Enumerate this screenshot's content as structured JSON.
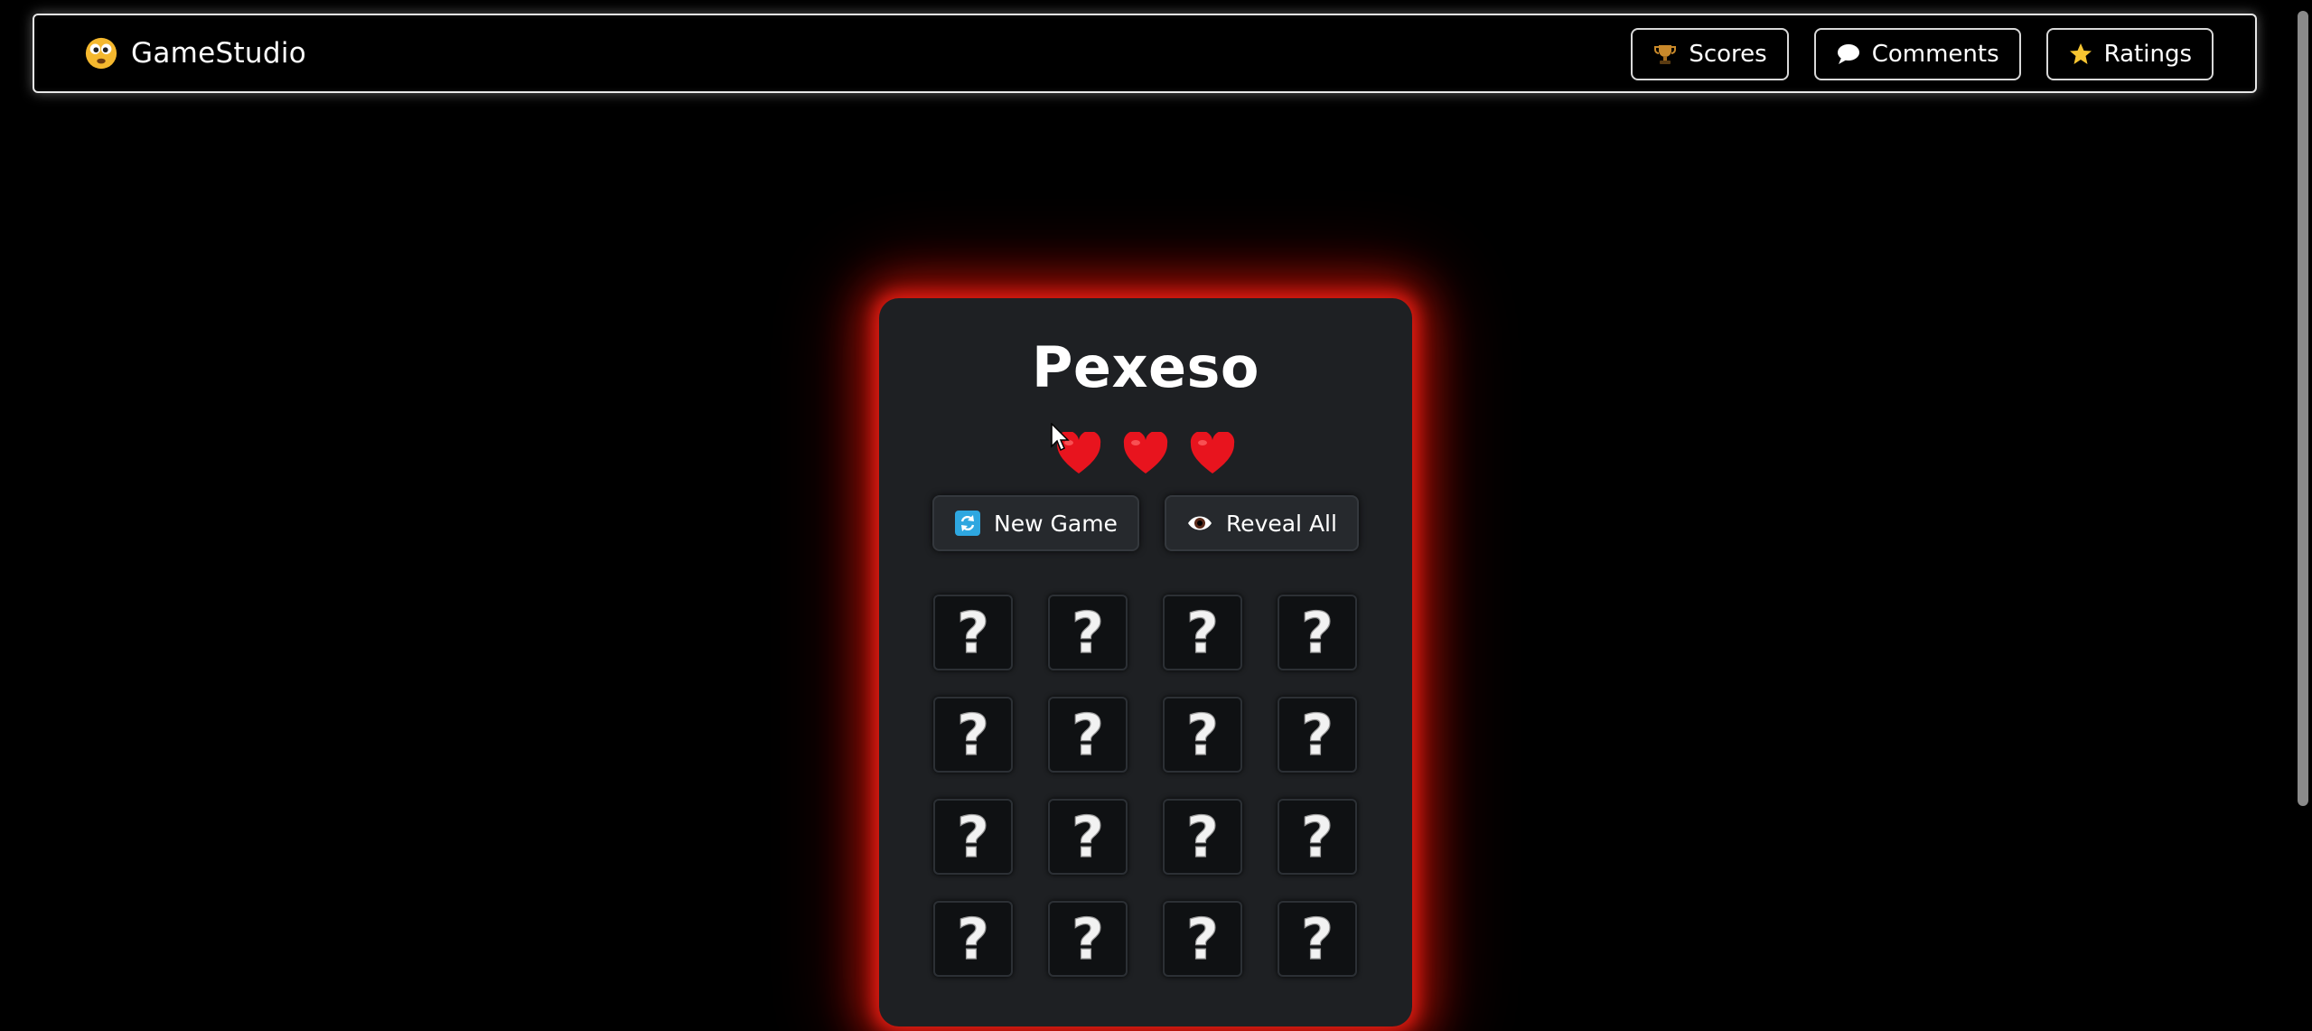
{
  "navbar": {
    "brand": "GameStudio",
    "brand_icon": "smiley-face-icon",
    "links": [
      {
        "label": "Scores",
        "icon": "trophy-icon"
      },
      {
        "label": "Comments",
        "icon": "speech-bubble-icon"
      },
      {
        "label": "Ratings",
        "icon": "star-icon"
      }
    ]
  },
  "game": {
    "title": "Pexeso",
    "lives": 3,
    "life_icon": "heart-icon",
    "buttons": {
      "new_game": "New Game",
      "reveal_all": "Reveal All"
    },
    "grid": {
      "rows": 4,
      "cols": 4,
      "tiles": [
        "?",
        "?",
        "?",
        "?",
        "?",
        "?",
        "?",
        "?",
        "?",
        "?",
        "?",
        "?",
        "?",
        "?",
        "?",
        "?"
      ]
    }
  },
  "colors": {
    "background": "#000000",
    "card": "#1e2023",
    "glow": "#e61e14",
    "heart": "#e8141e"
  }
}
